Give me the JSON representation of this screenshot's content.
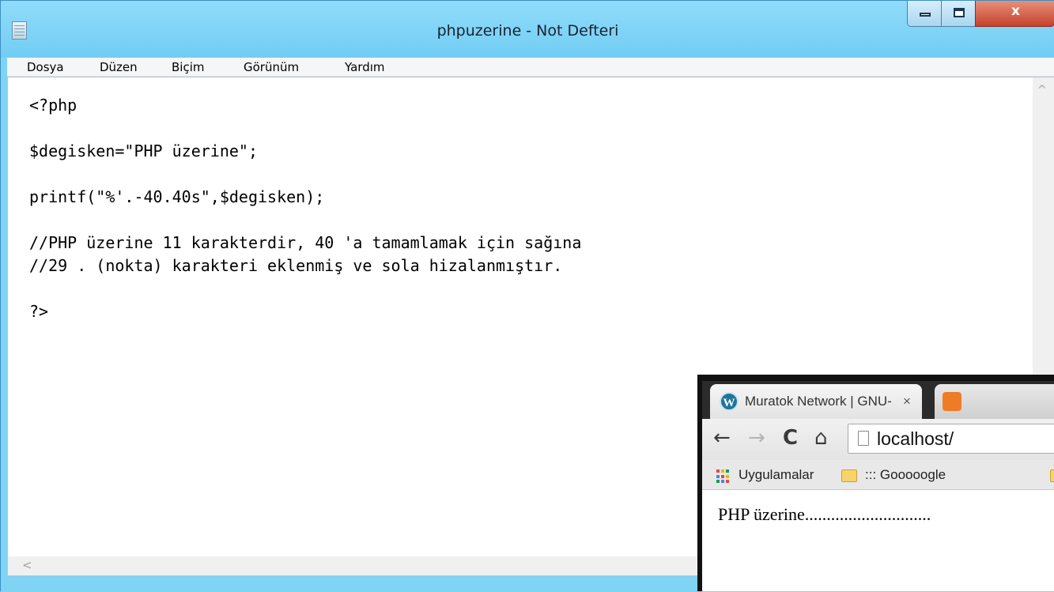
{
  "notepad": {
    "title": "phpuzerine - Not Defteri",
    "controls": {
      "minimize": "–",
      "maximize": "□",
      "close": "x"
    },
    "menu": [
      {
        "label": "Dosya"
      },
      {
        "label": "Düzen"
      },
      {
        "label": "Biçim"
      },
      {
        "label": "Görünüm"
      },
      {
        "label": "Yardım"
      }
    ],
    "lines": [
      "<?php",
      "",
      "$degisken=\"PHP üzerine\";",
      "",
      "printf(\"%'.-40.40s\",$degisken);",
      "",
      "//PHP üzerine 11 karakterdir, 40 'a tamamlamak için sağına",
      "//29 . (nokta) karakteri eklenmiş ve sola hizalanmıştır.",
      "",
      "?>"
    ],
    "scroll_up_glyph": "^",
    "scroll_left_glyph": "<"
  },
  "browser": {
    "tab_title": "Muratok Network | GNU-L",
    "tab_close": "×",
    "nav": {
      "back": "←",
      "forward": "→",
      "reload": "C",
      "home": "⌂"
    },
    "url": "localhost/",
    "bookmarks": [
      {
        "label": "Uygulamalar"
      },
      {
        "label": "::: Gooooogle"
      }
    ],
    "output": "PHP üzerine............................."
  },
  "colors": {
    "titlebar": "#7fd3f5",
    "close_button": "#c6412a",
    "apps_grid": [
      "#e04a3f",
      "#f4b400",
      "#0f9d58",
      "#4285f4",
      "#e04a3f",
      "#f4b400",
      "#0f9d58",
      "#4285f4",
      "#e04a3f"
    ]
  }
}
